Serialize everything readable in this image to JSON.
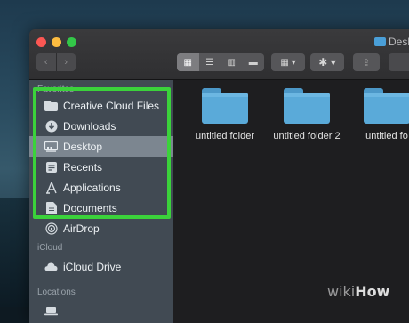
{
  "window": {
    "title": "Desk"
  },
  "toolbar": {
    "back_icon": "chevron-left-icon",
    "forward_icon": "chevron-right-icon",
    "view_modes": [
      "icon-view-icon",
      "list-view-icon",
      "column-view-icon",
      "gallery-view-icon"
    ],
    "group_icon": "group-by-icon",
    "action_icon": "gear-icon",
    "share_icon": "share-icon",
    "dropdown_glyph": "▾"
  },
  "sidebar": {
    "favorites_header": "Favorites",
    "favorites": [
      {
        "label": "Creative Cloud Files",
        "icon": "folder-icon"
      },
      {
        "label": "Downloads",
        "icon": "downloads-icon"
      },
      {
        "label": "Desktop",
        "icon": "desktop-icon",
        "selected": true
      },
      {
        "label": "Recents",
        "icon": "recents-icon"
      },
      {
        "label": "Applications",
        "icon": "applications-icon"
      },
      {
        "label": "Documents",
        "icon": "documents-icon"
      },
      {
        "label": "AirDrop",
        "icon": "airdrop-icon"
      }
    ],
    "icloud_header": "iCloud",
    "icloud": [
      {
        "label": "iCloud Drive",
        "icon": "cloud-icon"
      }
    ],
    "locations_header": "Locations"
  },
  "content": {
    "items": [
      {
        "name": "untitled folder"
      },
      {
        "name": "untitled folder 2"
      },
      {
        "name": "untitled fo"
      }
    ]
  },
  "colors": {
    "highlight": "#3bd23b",
    "folder": "#5aaad9"
  },
  "watermark": {
    "wiki": "wiki",
    "how": "How"
  }
}
